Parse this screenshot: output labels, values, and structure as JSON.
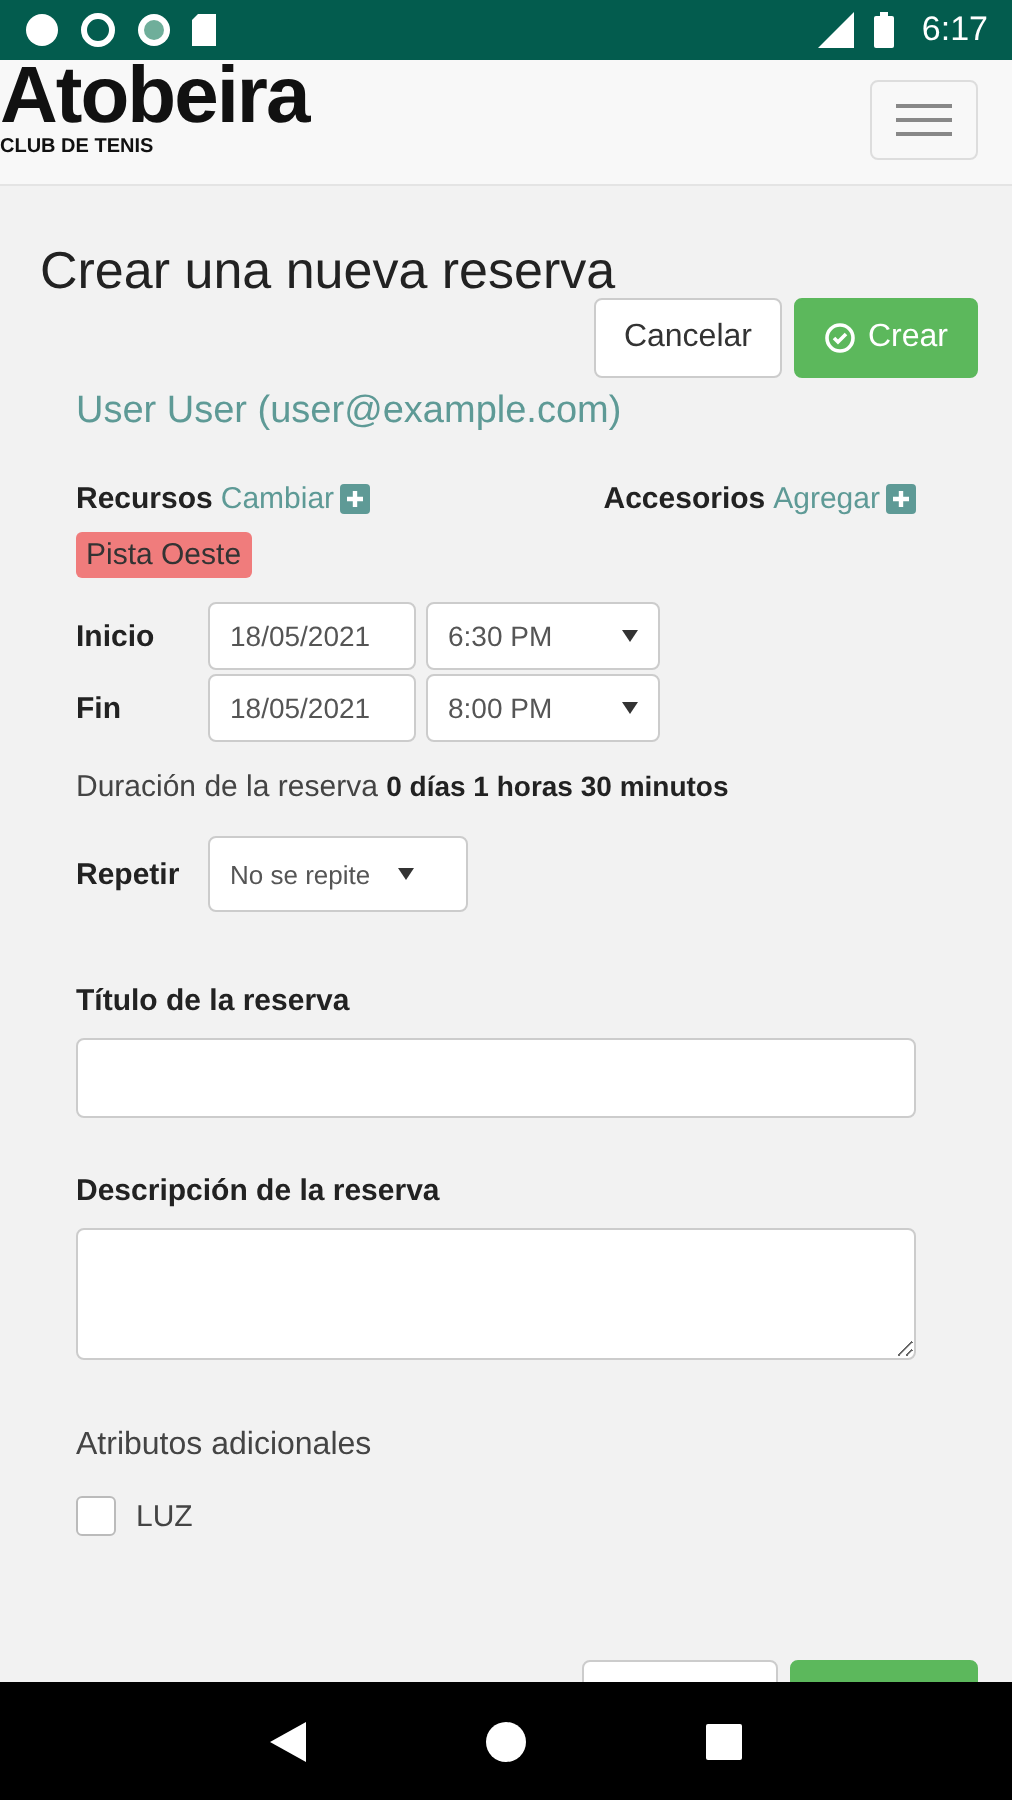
{
  "status_bar": {
    "time": "6:17"
  },
  "header": {
    "logo": "Atobeira",
    "logo_subtitle": "CLUB DE TENIS"
  },
  "page": {
    "title": "Crear una nueva reserva",
    "top_buttons": [
      {
        "kind": "cancel",
        "label": "Cancelar"
      },
      {
        "kind": "create",
        "label": "Crear"
      }
    ],
    "user": "User User (user@example.com)",
    "resources": {
      "label": "Recursos",
      "link": "Cambiar"
    },
    "accessories": {
      "label": "Accesorios",
      "link": "Agregar"
    },
    "resource_tags": [
      {
        "label": "Pista Oeste",
        "color": "#f07c7c"
      }
    ],
    "start": {
      "label": "Inicio",
      "date": "18/05/2021",
      "time": "6:30 PM"
    },
    "end": {
      "label": "Fin",
      "date": "18/05/2021",
      "time": "8:00 PM"
    },
    "duration": {
      "label": "Duración de la reserva",
      "value": "0 días 1 horas 30 minutos"
    },
    "repeat": {
      "label": "Repetir",
      "value": "No se repite"
    },
    "title_field": {
      "label": "Título de la reserva"
    },
    "description_field": {
      "label": "Descripción de la reserva"
    },
    "attributes": {
      "label": "Atributos adicionales",
      "items": [
        {
          "label": "LUZ",
          "checked": false
        }
      ]
    },
    "bottom_buttons": [
      {
        "kind": "cancel"
      },
      {
        "kind": "create"
      }
    ]
  }
}
